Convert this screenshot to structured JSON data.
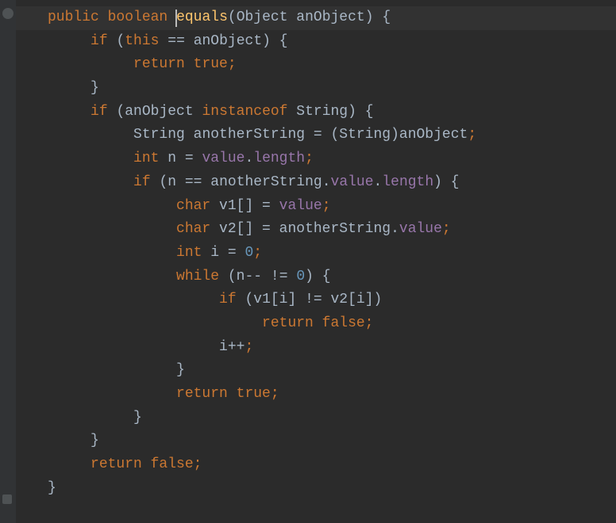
{
  "editor": {
    "theme": "darcula",
    "cursor_line": 0,
    "cursor_col": 20,
    "lines": [
      {
        "indent": 0,
        "tokens": [
          {
            "t": "kw",
            "v": "public"
          },
          {
            "t": "sp",
            "v": " "
          },
          {
            "t": "kw",
            "v": "boolean"
          },
          {
            "t": "sp",
            "v": " "
          },
          {
            "t": "cursor",
            "v": ""
          },
          {
            "t": "method-decl",
            "v": "equals"
          },
          {
            "t": "paren",
            "v": "("
          },
          {
            "t": "ident",
            "v": "Object anObject"
          },
          {
            "t": "paren",
            "v": ")"
          },
          {
            "t": "sp",
            "v": " "
          },
          {
            "t": "paren",
            "v": "{"
          }
        ]
      },
      {
        "indent": 1,
        "tokens": [
          {
            "t": "kw",
            "v": "if"
          },
          {
            "t": "sp",
            "v": " "
          },
          {
            "t": "paren",
            "v": "("
          },
          {
            "t": "this",
            "v": "this"
          },
          {
            "t": "sp",
            "v": " "
          },
          {
            "t": "op",
            "v": "=="
          },
          {
            "t": "sp",
            "v": " "
          },
          {
            "t": "ident",
            "v": "anObject"
          },
          {
            "t": "paren",
            "v": ")"
          },
          {
            "t": "sp",
            "v": " "
          },
          {
            "t": "paren",
            "v": "{"
          }
        ]
      },
      {
        "indent": 2,
        "tokens": [
          {
            "t": "kw",
            "v": "return true"
          },
          {
            "t": "semicolon",
            "v": ";"
          }
        ]
      },
      {
        "indent": 1,
        "tokens": [
          {
            "t": "paren",
            "v": "}"
          }
        ]
      },
      {
        "indent": 1,
        "tokens": [
          {
            "t": "kw",
            "v": "if"
          },
          {
            "t": "sp",
            "v": " "
          },
          {
            "t": "paren",
            "v": "("
          },
          {
            "t": "ident",
            "v": "anObject "
          },
          {
            "t": "kw",
            "v": "instanceof"
          },
          {
            "t": "ident",
            "v": " String"
          },
          {
            "t": "paren",
            "v": ")"
          },
          {
            "t": "sp",
            "v": " "
          },
          {
            "t": "paren",
            "v": "{"
          }
        ]
      },
      {
        "indent": 2,
        "tokens": [
          {
            "t": "ident",
            "v": "String anotherString = (String)anObject"
          },
          {
            "t": "semicolon",
            "v": ";"
          }
        ]
      },
      {
        "indent": 2,
        "tokens": [
          {
            "t": "kw",
            "v": "int"
          },
          {
            "t": "ident",
            "v": " n = "
          },
          {
            "t": "field",
            "v": "value"
          },
          {
            "t": "ident",
            "v": "."
          },
          {
            "t": "field",
            "v": "length"
          },
          {
            "t": "semicolon",
            "v": ";"
          }
        ]
      },
      {
        "indent": 2,
        "tokens": [
          {
            "t": "kw",
            "v": "if"
          },
          {
            "t": "sp",
            "v": " "
          },
          {
            "t": "paren",
            "v": "("
          },
          {
            "t": "ident",
            "v": "n "
          },
          {
            "t": "op",
            "v": "=="
          },
          {
            "t": "ident",
            "v": " anotherString."
          },
          {
            "t": "field",
            "v": "value"
          },
          {
            "t": "ident",
            "v": "."
          },
          {
            "t": "field",
            "v": "length"
          },
          {
            "t": "paren",
            "v": ")"
          },
          {
            "t": "sp",
            "v": " "
          },
          {
            "t": "paren",
            "v": "{"
          }
        ]
      },
      {
        "indent": 3,
        "tokens": [
          {
            "t": "kw",
            "v": "char"
          },
          {
            "t": "ident",
            "v": " v1[] = "
          },
          {
            "t": "field",
            "v": "value"
          },
          {
            "t": "semicolon",
            "v": ";"
          }
        ]
      },
      {
        "indent": 3,
        "tokens": [
          {
            "t": "kw",
            "v": "char"
          },
          {
            "t": "ident",
            "v": " v2[] = anotherString."
          },
          {
            "t": "field",
            "v": "value"
          },
          {
            "t": "semicolon",
            "v": ";"
          }
        ]
      },
      {
        "indent": 3,
        "tokens": [
          {
            "t": "kw",
            "v": "int"
          },
          {
            "t": "ident",
            "v": " i = "
          },
          {
            "t": "num",
            "v": "0"
          },
          {
            "t": "semicolon",
            "v": ";"
          }
        ]
      },
      {
        "indent": 3,
        "tokens": [
          {
            "t": "kw",
            "v": "while"
          },
          {
            "t": "sp",
            "v": " "
          },
          {
            "t": "paren",
            "v": "("
          },
          {
            "t": "ident",
            "v": "n-- "
          },
          {
            "t": "op",
            "v": "!="
          },
          {
            "t": "sp",
            "v": " "
          },
          {
            "t": "num",
            "v": "0"
          },
          {
            "t": "paren",
            "v": ")"
          },
          {
            "t": "sp",
            "v": " "
          },
          {
            "t": "paren",
            "v": "{"
          }
        ]
      },
      {
        "indent": 4,
        "tokens": [
          {
            "t": "kw",
            "v": "if"
          },
          {
            "t": "sp",
            "v": " "
          },
          {
            "t": "paren",
            "v": "("
          },
          {
            "t": "ident",
            "v": "v1[i] "
          },
          {
            "t": "op",
            "v": "!="
          },
          {
            "t": "ident",
            "v": " v2[i]"
          },
          {
            "t": "paren",
            "v": ")"
          }
        ]
      },
      {
        "indent": 5,
        "tokens": [
          {
            "t": "kw",
            "v": "return false"
          },
          {
            "t": "semicolon",
            "v": ";"
          }
        ]
      },
      {
        "indent": 4,
        "tokens": [
          {
            "t": "ident",
            "v": "i++"
          },
          {
            "t": "semicolon",
            "v": ";"
          }
        ]
      },
      {
        "indent": 3,
        "tokens": [
          {
            "t": "paren",
            "v": "}"
          }
        ]
      },
      {
        "indent": 3,
        "tokens": [
          {
            "t": "kw",
            "v": "return true"
          },
          {
            "t": "semicolon",
            "v": ";"
          }
        ]
      },
      {
        "indent": 2,
        "tokens": [
          {
            "t": "paren",
            "v": "}"
          }
        ]
      },
      {
        "indent": 1,
        "tokens": [
          {
            "t": "paren",
            "v": "}"
          }
        ]
      },
      {
        "indent": 1,
        "tokens": [
          {
            "t": "kw",
            "v": "return false"
          },
          {
            "t": "semicolon",
            "v": ";"
          }
        ]
      },
      {
        "indent": 0,
        "tokens": [
          {
            "t": "paren",
            "v": "}"
          }
        ]
      }
    ]
  }
}
